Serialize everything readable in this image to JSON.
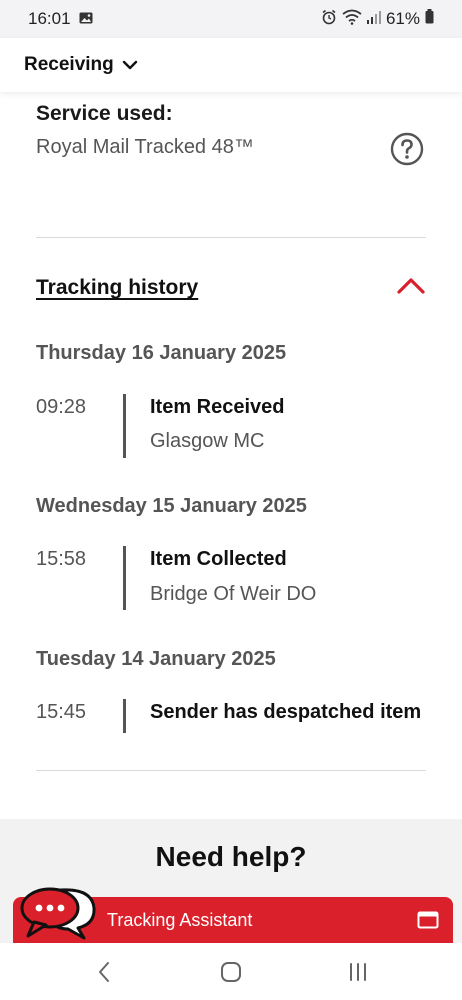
{
  "status_bar": {
    "time": "16:01",
    "battery": "61%",
    "icons": [
      "image-icon",
      "alarm-icon",
      "wifi-icon",
      "signal-icon",
      "battery-icon"
    ]
  },
  "header": {
    "title": "Receiving",
    "dropdown_icon": "chevron-down-icon"
  },
  "service": {
    "label": "Service used:",
    "value": "Royal Mail Tracked 48™",
    "help_icon": "question-circle-icon"
  },
  "tracking": {
    "title": "Tracking history",
    "toggle_icon": "chevron-up-icon",
    "days": [
      {
        "heading": "Thursday 16 January 2025",
        "events": [
          {
            "time": "09:28",
            "title": "Item Received",
            "location": "Glasgow MC"
          }
        ]
      },
      {
        "heading": "Wednesday 15 January 2025",
        "events": [
          {
            "time": "15:58",
            "title": "Item Collected",
            "location": "Bridge Of Weir DO"
          }
        ]
      },
      {
        "heading": "Tuesday 14 January 2025",
        "events": [
          {
            "time": "15:45",
            "title": "Sender has despatched item",
            "location": ""
          }
        ]
      }
    ]
  },
  "help": {
    "title": "Need help?"
  },
  "assistant": {
    "label": "Tracking Assistant",
    "chat_icon": "chat-bubbles-icon",
    "window_icon": "window-icon"
  },
  "nav": {
    "icons": [
      "back-icon",
      "home-icon",
      "recents-icon"
    ]
  },
  "colors": {
    "accent": "#da202a",
    "status_bar_bg": "#f3f3f5",
    "help_bg": "#f2f2f2"
  }
}
